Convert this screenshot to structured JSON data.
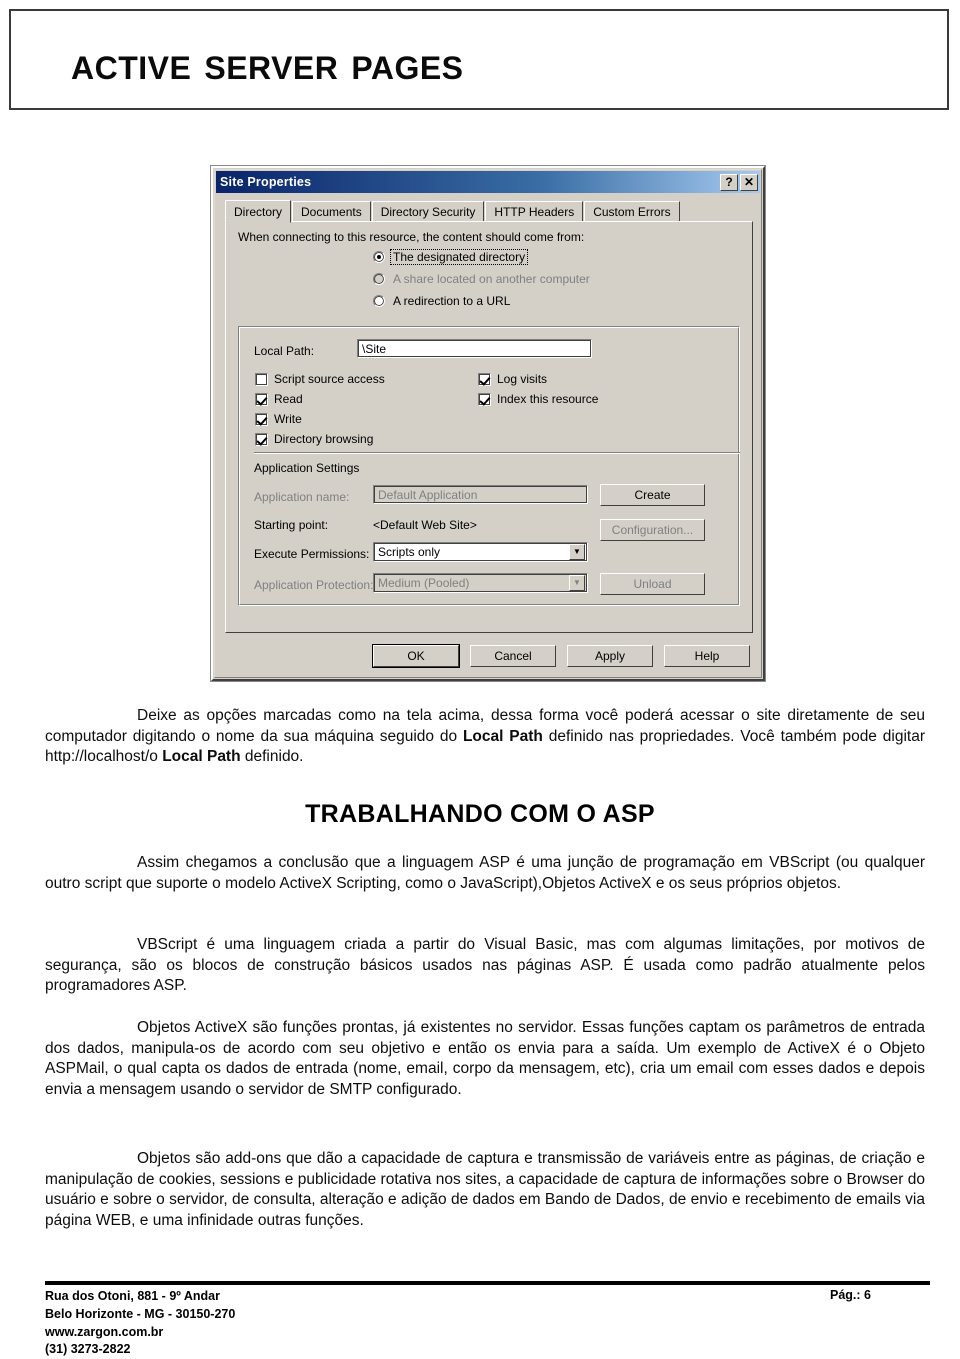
{
  "header": {
    "title": "Active Server Pages"
  },
  "dialog": {
    "titlebar": {
      "title": "Site Properties",
      "help_button": "?",
      "close_button": "✕"
    },
    "tabs": [
      {
        "label": "Directory",
        "active": true
      },
      {
        "label": "Documents",
        "active": false
      },
      {
        "label": "Directory Security",
        "active": false
      },
      {
        "label": "HTTP Headers",
        "active": false
      },
      {
        "label": "Custom Errors",
        "active": false
      }
    ],
    "prompt": "When connecting to this resource, the content should come from:",
    "source_options": [
      {
        "label": "The designated directory",
        "selected": true,
        "disabled": false
      },
      {
        "label": "A share located on another computer",
        "selected": false,
        "disabled": true
      },
      {
        "label": "A redirection to a URL",
        "selected": false,
        "disabled": false
      }
    ],
    "local_path": {
      "label": "Local Path:",
      "value": "\\Site"
    },
    "permissions_left": [
      {
        "label": "Script source access",
        "checked": false
      },
      {
        "label": "Read",
        "checked": true
      },
      {
        "label": "Write",
        "checked": true
      },
      {
        "label": "Directory browsing",
        "checked": true
      }
    ],
    "permissions_right": [
      {
        "label": "Log visits",
        "checked": true
      },
      {
        "label": "Index this resource",
        "checked": true
      }
    ],
    "app_settings": {
      "group_label": "Application Settings",
      "application_name_label": "Application name:",
      "application_name_value": "Default Application",
      "starting_point_label": "Starting point:",
      "starting_point_value": "<Default Web Site>",
      "execute_permissions_label": "Execute Permissions:",
      "execute_permissions_value": "Scripts only",
      "application_protection_label": "Application Protection:",
      "application_protection_value": "Medium (Pooled)",
      "create_button": "Create",
      "configuration_button": "Configuration...",
      "unload_button": "Unload"
    },
    "footer_buttons": [
      {
        "label": "OK",
        "default": true
      },
      {
        "label": "Cancel",
        "default": false
      },
      {
        "label": "Apply",
        "default": false
      },
      {
        "label": "Help",
        "default": false
      }
    ]
  },
  "content": {
    "caption_paragraph_part1": "Deixe as opções marcadas como na tela acima, dessa forma você poderá acessar o site diretamente de seu computador digitando o nome da sua máquina seguido do ",
    "caption_bold1": "Local Path",
    "caption_paragraph_part2": " definido nas propriedades. Você também pode digitar http://localhost/o ",
    "caption_bold2": "Local Path",
    "caption_paragraph_part3": " definido.",
    "section_heading": "TRABALHANDO COM O ASP",
    "paragraph_1": "Assim chegamos a conclusão que a linguagem ASP é uma junção de programação em VBScript (ou qualquer outro script que suporte o modelo ActiveX Scripting, como o JavaScript),Objetos ActiveX e os seus próprios objetos.",
    "paragraph_2": "VBScript é uma linguagem criada a partir do Visual Basic, mas com algumas limitações, por motivos de segurança, são os blocos de construção básicos usados nas páginas ASP. É usada como padrão atualmente pelos programadores ASP.",
    "paragraph_3": "Objetos ActiveX são funções prontas, já existentes no servidor. Essas funções captam os parâmetros de entrada dos dados, manipula-os de acordo com seu objetivo e então os envia para a saída. Um exemplo de ActiveX é o Objeto ASPMail, o qual capta os dados de entrada (nome, email, corpo da mensagem, etc), cria um email com esses dados e depois envia a mensagem usando o servidor de SMTP configurado.",
    "paragraph_4": "Objetos são add-ons que dão a capacidade de captura e transmissão de variáveis entre as páginas, de criação e manipulação de cookies, sessions e publicidade rotativa nos sites, a capacidade de captura de informações sobre o Browser do usuário e sobre o servidor, de consulta, alteração e adição de dados em Bando de Dados, de envio e recebimento de emails via página WEB, e uma infinidade outras funções."
  },
  "footer": {
    "address_line1": "Rua dos Otoni, 881 - 9º Andar",
    "address_line2": "Belo Horizonte - MG - 30150-270",
    "website": "www.zargon.com.br",
    "phone": "(31) 3273-2822",
    "page_number": "Pág.: 6"
  }
}
